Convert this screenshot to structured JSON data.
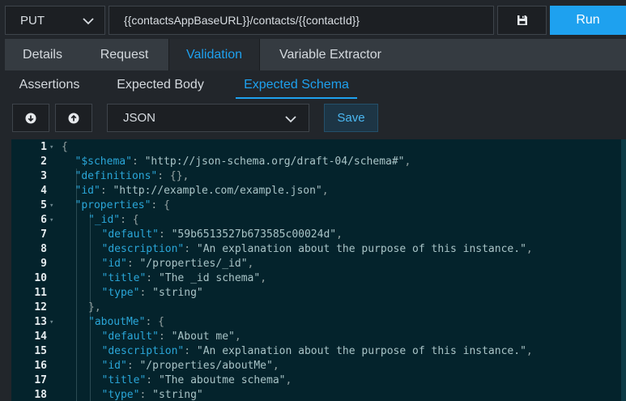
{
  "request": {
    "method": "PUT",
    "url": "{{contactsAppBaseURL}}/contacts/{{contactId}}",
    "run_label": "Run"
  },
  "tabs": [
    "Details",
    "Request",
    "Validation",
    "Variable Extractor"
  ],
  "active_tab": "Validation",
  "subtabs": [
    "Assertions",
    "Expected Body",
    "Expected Schema"
  ],
  "active_subtab": "Expected Schema",
  "toolbar": {
    "format": "JSON",
    "save_label": "Save"
  },
  "colors": {
    "accent": "#1ea1ef",
    "editor_bg": "#04232c",
    "key": "#2aa6d8",
    "string": "#a9c4c7"
  },
  "editor": {
    "lines": [
      {
        "n": "1",
        "fold": true,
        "indent": 0,
        "tokens": [
          {
            "t": "p",
            "v": "{"
          }
        ]
      },
      {
        "n": "2",
        "fold": false,
        "indent": 1,
        "tokens": [
          {
            "t": "k",
            "v": "\"$schema\""
          },
          {
            "t": "p",
            "v": ": "
          },
          {
            "t": "s",
            "v": "\"http://json-schema.org/draft-04/schema#\""
          },
          {
            "t": "p",
            "v": ","
          }
        ]
      },
      {
        "n": "3",
        "fold": false,
        "indent": 1,
        "tokens": [
          {
            "t": "k",
            "v": "\"definitions\""
          },
          {
            "t": "p",
            "v": ": {},"
          }
        ]
      },
      {
        "n": "4",
        "fold": false,
        "indent": 1,
        "tokens": [
          {
            "t": "k",
            "v": "\"id\""
          },
          {
            "t": "p",
            "v": ": "
          },
          {
            "t": "s",
            "v": "\"http://example.com/example.json\""
          },
          {
            "t": "p",
            "v": ","
          }
        ]
      },
      {
        "n": "5",
        "fold": true,
        "indent": 1,
        "tokens": [
          {
            "t": "k",
            "v": "\"properties\""
          },
          {
            "t": "p",
            "v": ": {"
          }
        ]
      },
      {
        "n": "6",
        "fold": true,
        "indent": 2,
        "tokens": [
          {
            "t": "k",
            "v": "\"_id\""
          },
          {
            "t": "p",
            "v": ": {"
          }
        ]
      },
      {
        "n": "7",
        "fold": false,
        "indent": 3,
        "tokens": [
          {
            "t": "k",
            "v": "\"default\""
          },
          {
            "t": "p",
            "v": ": "
          },
          {
            "t": "s",
            "v": "\"59b6513527b673585c00024d\""
          },
          {
            "t": "p",
            "v": ","
          }
        ]
      },
      {
        "n": "8",
        "fold": false,
        "indent": 3,
        "tokens": [
          {
            "t": "k",
            "v": "\"description\""
          },
          {
            "t": "p",
            "v": ": "
          },
          {
            "t": "s",
            "v": "\"An explanation about the purpose of this instance.\""
          },
          {
            "t": "p",
            "v": ","
          }
        ]
      },
      {
        "n": "9",
        "fold": false,
        "indent": 3,
        "tokens": [
          {
            "t": "k",
            "v": "\"id\""
          },
          {
            "t": "p",
            "v": ": "
          },
          {
            "t": "s",
            "v": "\"/properties/_id\""
          },
          {
            "t": "p",
            "v": ","
          }
        ]
      },
      {
        "n": "10",
        "fold": false,
        "indent": 3,
        "tokens": [
          {
            "t": "k",
            "v": "\"title\""
          },
          {
            "t": "p",
            "v": ": "
          },
          {
            "t": "s",
            "v": "\"The _id schema\""
          },
          {
            "t": "p",
            "v": ","
          }
        ]
      },
      {
        "n": "11",
        "fold": false,
        "indent": 3,
        "tokens": [
          {
            "t": "k",
            "v": "\"type\""
          },
          {
            "t": "p",
            "v": ": "
          },
          {
            "t": "s",
            "v": "\"string\""
          }
        ]
      },
      {
        "n": "12",
        "fold": false,
        "indent": 2,
        "tokens": [
          {
            "t": "p",
            "v": "},"
          }
        ]
      },
      {
        "n": "13",
        "fold": true,
        "indent": 2,
        "tokens": [
          {
            "t": "k",
            "v": "\"aboutMe\""
          },
          {
            "t": "p",
            "v": ": {"
          }
        ]
      },
      {
        "n": "14",
        "fold": false,
        "indent": 3,
        "tokens": [
          {
            "t": "k",
            "v": "\"default\""
          },
          {
            "t": "p",
            "v": ": "
          },
          {
            "t": "s",
            "v": "\"About me\""
          },
          {
            "t": "p",
            "v": ","
          }
        ]
      },
      {
        "n": "15",
        "fold": false,
        "indent": 3,
        "tokens": [
          {
            "t": "k",
            "v": "\"description\""
          },
          {
            "t": "p",
            "v": ": "
          },
          {
            "t": "s",
            "v": "\"An explanation about the purpose of this instance.\""
          },
          {
            "t": "p",
            "v": ","
          }
        ]
      },
      {
        "n": "16",
        "fold": false,
        "indent": 3,
        "tokens": [
          {
            "t": "k",
            "v": "\"id\""
          },
          {
            "t": "p",
            "v": ": "
          },
          {
            "t": "s",
            "v": "\"/properties/aboutMe\""
          },
          {
            "t": "p",
            "v": ","
          }
        ]
      },
      {
        "n": "17",
        "fold": false,
        "indent": 3,
        "tokens": [
          {
            "t": "k",
            "v": "\"title\""
          },
          {
            "t": "p",
            "v": ": "
          },
          {
            "t": "s",
            "v": "\"The aboutme schema\""
          },
          {
            "t": "p",
            "v": ","
          }
        ]
      },
      {
        "n": "18",
        "fold": false,
        "indent": 3,
        "tokens": [
          {
            "t": "k",
            "v": "\"type\""
          },
          {
            "t": "p",
            "v": ": "
          },
          {
            "t": "s",
            "v": "\"string\""
          }
        ]
      }
    ]
  }
}
